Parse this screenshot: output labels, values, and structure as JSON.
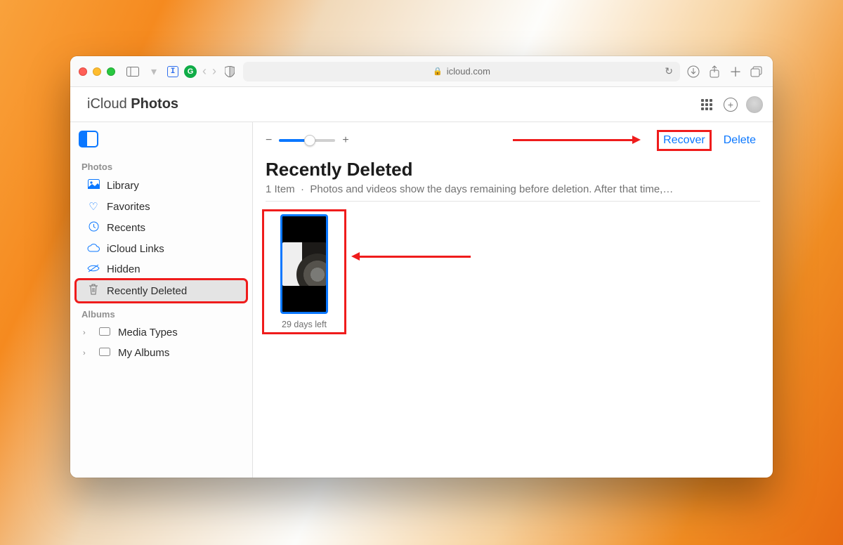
{
  "browser": {
    "url_display": "icloud.com"
  },
  "header": {
    "service": "iCloud",
    "app": "Photos"
  },
  "sidebar": {
    "section_photos": "Photos",
    "section_albums": "Albums",
    "items": [
      {
        "label": "Library"
      },
      {
        "label": "Favorites"
      },
      {
        "label": "Recents"
      },
      {
        "label": "iCloud Links"
      },
      {
        "label": "Hidden"
      },
      {
        "label": "Recently Deleted"
      }
    ],
    "albums": [
      {
        "label": "Media Types"
      },
      {
        "label": "My Albums"
      }
    ]
  },
  "toolbar": {
    "recover_label": "Recover",
    "delete_label": "Delete"
  },
  "content": {
    "title": "Recently Deleted",
    "subtitle_count": "1 Item",
    "subtitle_sep": "·",
    "subtitle_text": "Photos and videos show the days remaining before deletion. After that time,…",
    "thumb_caption": "29 days left"
  },
  "colors": {
    "accent": "#0a77ff",
    "annotation": "#ef1c1c"
  }
}
